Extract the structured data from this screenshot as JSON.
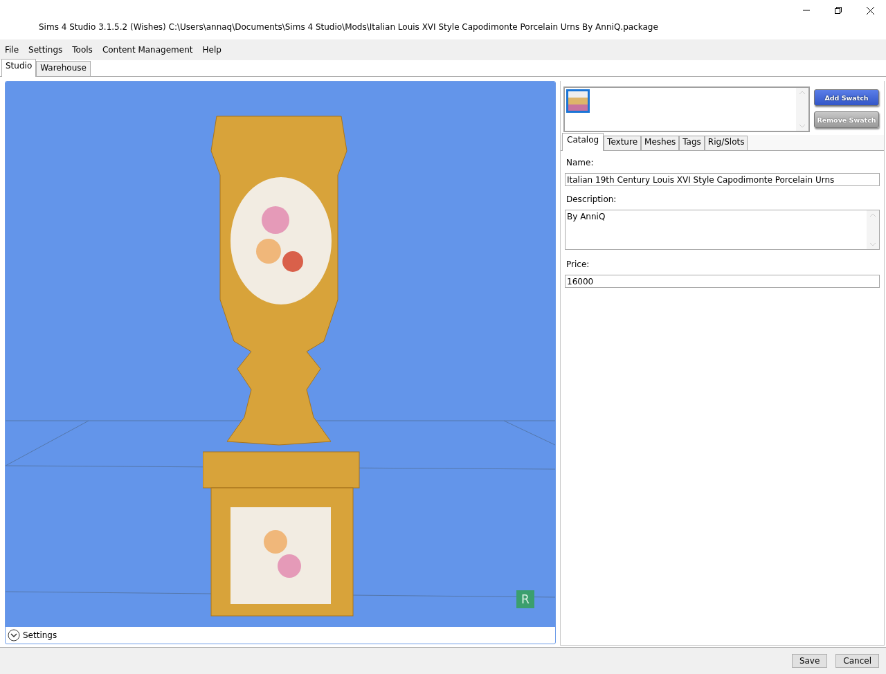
{
  "window": {
    "title": "Sims 4 Studio 3.1.5.2 (Wishes)  C:\\Users\\annaq\\Documents\\Sims 4 Studio\\Mods\\Italian Louis XVI Style Capodimonte Porcelain Urns By AnniQ.package"
  },
  "menu": [
    "File",
    "Settings",
    "Tools",
    "Content Management",
    "Help"
  ],
  "tabs": [
    {
      "label": "Studio",
      "selected": true
    },
    {
      "label": "Warehouse",
      "selected": false
    }
  ],
  "viewport": {
    "badge": "R",
    "settings_label": "Settings"
  },
  "swatches": [
    {
      "selected": true
    }
  ],
  "swatch_buttons": [
    {
      "label": "Add Swatch",
      "kind": "primary"
    },
    {
      "label": "Remove Swatch",
      "kind": "secondary"
    }
  ],
  "detail_tabs": [
    {
      "label": "Catalog",
      "selected": true
    },
    {
      "label": "Texture",
      "selected": false
    },
    {
      "label": "Meshes",
      "selected": false
    },
    {
      "label": "Tags",
      "selected": false
    },
    {
      "label": "Rig/Slots",
      "selected": false
    }
  ],
  "fields": [
    {
      "label": "Name:",
      "value": "Italian 19th Century Louis XVI Style Capodimonte Porcelain Urns",
      "kind": "line"
    },
    {
      "label": "Description:",
      "value": "By AnniQ",
      "kind": "multiline"
    },
    {
      "label": "Price:",
      "value": "16000",
      "kind": "line"
    }
  ],
  "footer_buttons": [
    "Save",
    "Cancel"
  ]
}
